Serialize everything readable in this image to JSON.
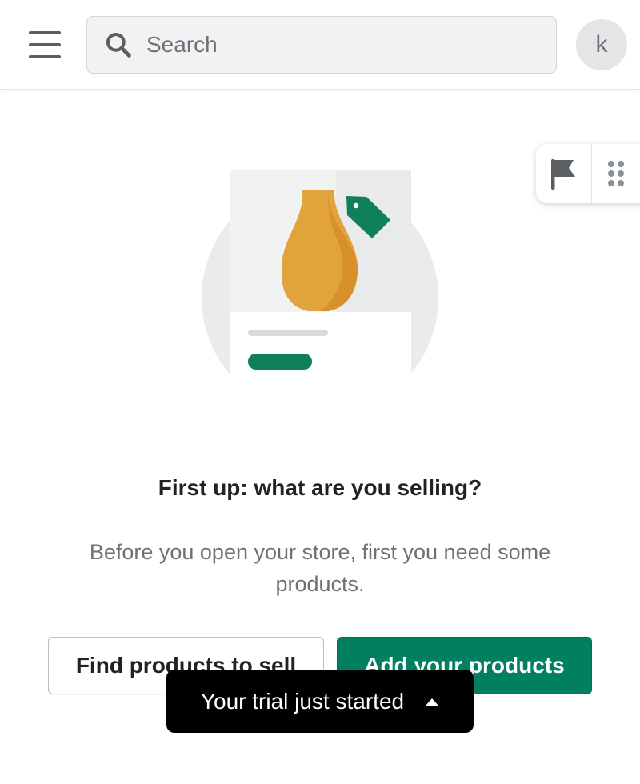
{
  "topbar": {
    "menu_icon": "hamburger-menu-icon",
    "search": {
      "placeholder": "Search",
      "icon": "search-icon"
    },
    "avatar_initial": "k"
  },
  "floating_tools": {
    "flag_icon": "flag-icon",
    "grip_icon": "drag-grip-icon"
  },
  "empty_state": {
    "illustration": "product-card-vase-illustration",
    "heading": "First up: what are you selling?",
    "description": "Before you open your store, first you need some products."
  },
  "actions": {
    "find_products_label": "Find products to sell",
    "add_products_label": "Add your products"
  },
  "toast": {
    "text": "Your trial just started",
    "icon": "caret-up-icon"
  },
  "colors": {
    "primary": "#008060",
    "illustration_green": "#0f7f5c",
    "vase_orange": "#e2a33c",
    "toast_bg": "#000000"
  }
}
